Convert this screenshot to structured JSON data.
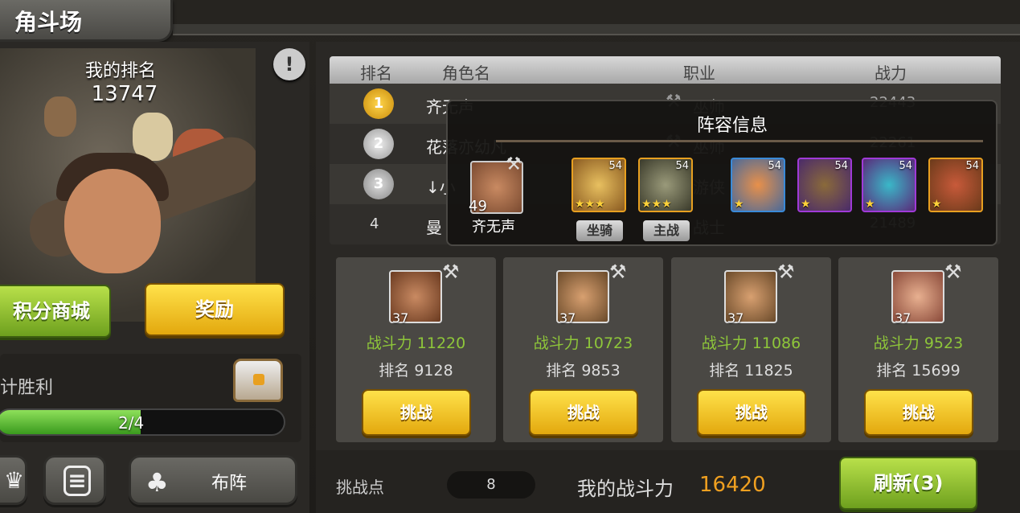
{
  "header": {
    "title": "角斗场"
  },
  "my_rank": {
    "label": "我的排名",
    "value": "13747"
  },
  "info_icon": "!",
  "buttons": {
    "shop": "积分商城",
    "reward": "奖励",
    "formation": "布阵",
    "refresh": "刷新(3)",
    "challenge": "挑战"
  },
  "wins": {
    "label": "计胜利",
    "progress_text": "2/4",
    "progress": 0.5
  },
  "table": {
    "headers": {
      "rank": "排名",
      "name": "角色名",
      "job": "职业",
      "power": "战力"
    },
    "rows": [
      {
        "rank": "1",
        "name": "齐无声",
        "job": "巫师",
        "power": "22443"
      },
      {
        "rank": "2",
        "name": "花落亦幼凡",
        "job": "巫师",
        "power": "22261"
      },
      {
        "rank": "3",
        "name": "↓小",
        "job": "游侠",
        "power": ""
      },
      {
        "rank": "4",
        "name": "曼",
        "job": "战士",
        "power": "21489"
      }
    ]
  },
  "lineup": {
    "title": "阵容信息",
    "player": {
      "level": "49",
      "name": "齐无声"
    },
    "pets": [
      {
        "level": "54",
        "stars": "★★★",
        "color": "#e8a020",
        "tag": "坐骑"
      },
      {
        "level": "54",
        "stars": "★★★",
        "color": "#e8a020",
        "tag": "主战"
      },
      {
        "level": "54",
        "stars": "★",
        "color": "#3a8ad8"
      },
      {
        "level": "54",
        "stars": "★",
        "color": "#a03ad8"
      },
      {
        "level": "54",
        "stars": "★",
        "color": "#a03ad8"
      },
      {
        "level": "54",
        "stars": "★",
        "color": "#e8a020"
      }
    ]
  },
  "opponents": [
    {
      "level": "37",
      "power": "战斗力 11220",
      "rank": "排名 9128"
    },
    {
      "level": "37",
      "power": "战斗力 10723",
      "rank": "排名 9853"
    },
    {
      "level": "37",
      "power": "战斗力 11086",
      "rank": "排名 11825"
    },
    {
      "level": "37",
      "power": "战斗力 9523",
      "rank": "排名 15699"
    }
  ],
  "footer": {
    "challenge_points_label": "挑战点",
    "challenge_points": "8",
    "my_power_label": "我的战斗力",
    "my_power": "16420"
  }
}
